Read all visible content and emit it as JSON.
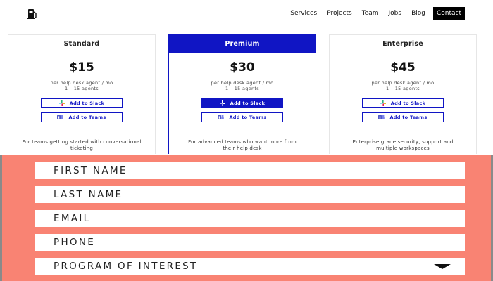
{
  "nav": {
    "links": [
      "Services",
      "Projects",
      "Team",
      "Jobs",
      "Blog"
    ],
    "contact": "Contact"
  },
  "pricing": {
    "plans": [
      {
        "name": "Standard",
        "price": "$15",
        "unit": "per help desk agent / mo",
        "agents": "1 – 15 agents",
        "slack_label": "Add to Slack",
        "teams_label": "Add to Teams",
        "description": "For teams getting started with conversational ticketing"
      },
      {
        "name": "Premium",
        "price": "$30",
        "unit": "per help desk agent / mo",
        "agents": "1 – 15 agents",
        "slack_label": "Add to Slack",
        "teams_label": "Add to Teams",
        "description": "For advanced teams who want more from their help desk"
      },
      {
        "name": "Enterprise",
        "price": "$45",
        "unit": "per help desk agent / mo",
        "agents": "1 – 15 agents",
        "slack_label": "Add to Slack",
        "teams_label": "Add to Teams",
        "description": "Enterprise grade security, support and multiple workspaces"
      }
    ]
  },
  "form": {
    "first_name_placeholder": "FIRST NAME",
    "last_name_placeholder": "LAST NAME",
    "email_placeholder": "EMAIL",
    "phone_placeholder": "PHONE",
    "program_label": "PROGRAM OF INTEREST"
  },
  "colors": {
    "brand_blue": "#1015c4",
    "form_background": "#f98373",
    "nav_contact_bg": "#000000"
  },
  "icons": {
    "logo": "fuel-pump-icon",
    "slack": "slack-icon",
    "teams": "teams-icon",
    "dropdown": "caret-down-icon"
  }
}
